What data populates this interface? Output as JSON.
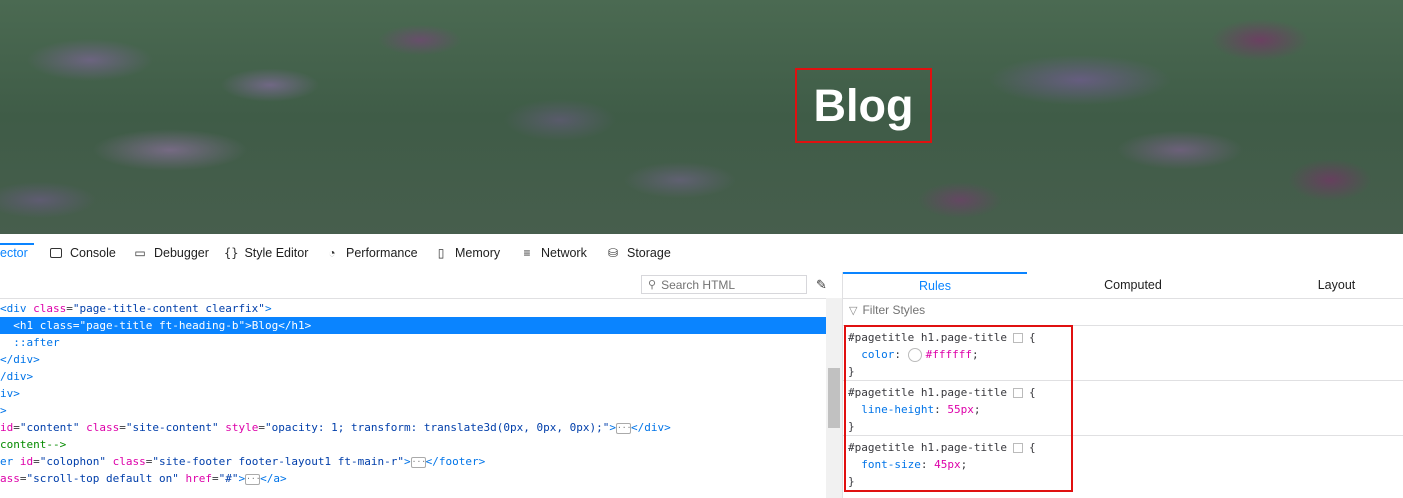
{
  "hero": {
    "title": "Blog"
  },
  "toolbar": {
    "tabs": [
      {
        "label": "ector",
        "icon": "inspector-icon"
      },
      {
        "label": "Console",
        "icon": "console-icon"
      },
      {
        "label": "Debugger",
        "icon": "debugger-icon"
      },
      {
        "label": "Style Editor",
        "icon": "braces-icon"
      },
      {
        "label": "Performance",
        "icon": "gauge-icon"
      },
      {
        "label": "Memory",
        "icon": "chip-icon"
      },
      {
        "label": "Network",
        "icon": "network-icon"
      },
      {
        "label": "Storage",
        "icon": "database-icon"
      }
    ]
  },
  "markup": {
    "search_placeholder": "Search HTML",
    "lines": {
      "l1_tag": "<div",
      "l1_attr": "class",
      "l1_val": "\"page-title-content clearfix\"",
      "l1_end": ">",
      "l2_tag": "<h1",
      "l2_attr": "class",
      "l2_val": "\"page-title ft-heading-b\"",
      "l2_end": ">Blog</h1>",
      "l3": "::after",
      "l4": "</div>",
      "l5": "/div>",
      "l6": "iv>",
      "l7": ">",
      "l8_attr1": "id",
      "l8_val1": "\"content\"",
      "l8_attr2": "class",
      "l8_val2": "\"site-content\"",
      "l8_attr3": "style",
      "l8_val3": "\"opacity: 1; transform: translate3d(0px, 0px, 0px);\"",
      "l8_end": "</div>",
      "l9": "content-->",
      "l10_tag": "er",
      "l10_attr1": "id",
      "l10_val1": "\"colophon\"",
      "l10_attr2": "class",
      "l10_val2": "\"site-footer footer-layout1 ft-main-r\"",
      "l10_end": "</footer>",
      "l11_attr1": "ass",
      "l11_val1": "\"scroll-top default on\"",
      "l11_attr2": "href",
      "l11_val2": "\"#\"",
      "l11_end": "</a>"
    }
  },
  "rules_panel": {
    "tabs": [
      "Rules",
      "Computed",
      "Layout"
    ],
    "filter_placeholder": "Filter Styles",
    "rules": [
      {
        "selector": "#pagetitle h1.page-title",
        "prop": "color",
        "value": "#ffffff"
      },
      {
        "selector": "#pagetitle h1.page-title",
        "prop": "line-height",
        "value": "55px"
      },
      {
        "selector": "#pagetitle h1.page-title",
        "prop": "font-size",
        "value": "45px"
      }
    ]
  },
  "colors": {
    "accent": "#0a84ff",
    "highlight_box": "#e01010",
    "title_text": "#ffffff"
  }
}
